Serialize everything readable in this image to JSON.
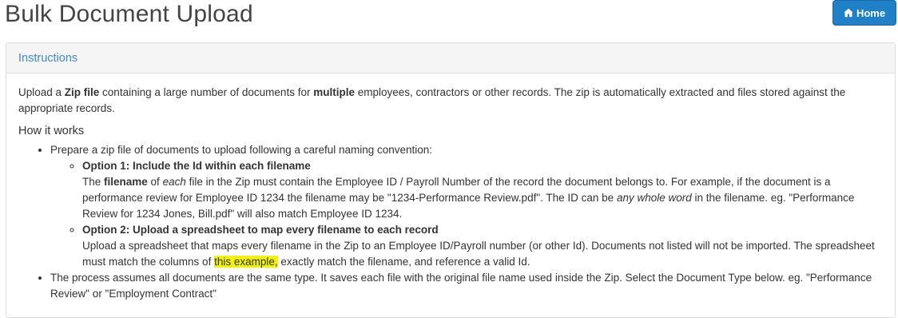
{
  "page_title": "Bulk Document Upload",
  "home_button": {
    "label": "Home",
    "icon": "home-icon"
  },
  "panel": {
    "heading": "Instructions",
    "intro": {
      "p1": "Upload a ",
      "b1": "Zip file",
      "p2": " containing a large number of documents for ",
      "b2": "multiple",
      "p3": " employees, contractors or other records. The zip is automatically extracted and files stored against the appropriate records."
    },
    "how_it_works": "How it works",
    "bullet1": "Prepare a zip file of documents to upload following a careful naming convention:",
    "option1": {
      "title": "Option 1: Include the Id within each filename",
      "t1": "The ",
      "b1": "filename",
      "t2": " of ",
      "i1": "each",
      "t3": " file in the Zip must contain the Employee ID / Payroll Number of the record the document belongs to. For example, if the document is a performance review for Employee ID 1234 the filename may be \"1234-Performance Review.pdf\". The ID can be ",
      "i2": "any whole word",
      "t4": " in the filename. eg. \"Performance Review for 1234 Jones, Bill.pdf\" will also match Employee ID 1234."
    },
    "option2": {
      "title": "Option 2: Upload a spreadsheet to map every filename to each record",
      "t1": "Upload a spreadsheet that maps every filename in the Zip to an Employee ID/Payroll number (or other Id). Documents not listed will not be imported. The spreadsheet must match the columns of ",
      "link": "this example,",
      "t2": " exactly match the filename, and reference a valid Id."
    },
    "bullet2": "The process assumes all documents are the same type. It saves each file with the original file name used inside the Zip. Select the Document Type below. eg. \"Performance Review\" or \"Employment Contract\""
  },
  "colors": {
    "primary": "#1f7fc7",
    "heading_text": "#3a8dc8",
    "highlight": "#f2f20a"
  }
}
